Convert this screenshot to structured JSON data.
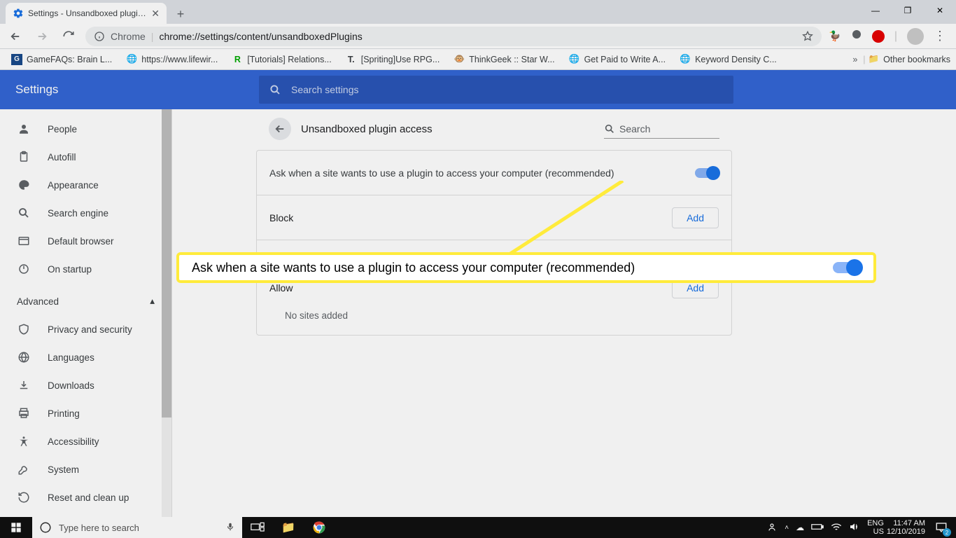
{
  "browser": {
    "tab_title": "Settings - Unsandboxed plugin a",
    "url_prefix": "Chrome",
    "url_path": "chrome://settings/content/unsandboxedPlugins",
    "bookmarks": [
      "GameFAQs: Brain L...",
      "https://www.lifewir...",
      "[Tutorials] Relations...",
      "[Spriting]Use RPG...",
      "ThinkGeek :: Star W...",
      "Get Paid to Write A...",
      "Keyword Density C..."
    ],
    "other_bookmarks": "Other bookmarks"
  },
  "settings": {
    "title": "Settings",
    "search_placeholder": "Search settings",
    "sidebar": {
      "items": [
        {
          "label": "People"
        },
        {
          "label": "Autofill"
        },
        {
          "label": "Appearance"
        },
        {
          "label": "Search engine"
        },
        {
          "label": "Default browser"
        },
        {
          "label": "On startup"
        }
      ],
      "advanced_label": "Advanced",
      "advanced_items": [
        {
          "label": "Privacy and security"
        },
        {
          "label": "Languages"
        },
        {
          "label": "Downloads"
        },
        {
          "label": "Printing"
        },
        {
          "label": "Accessibility"
        },
        {
          "label": "System"
        },
        {
          "label": "Reset and clean up"
        }
      ]
    },
    "panel": {
      "title": "Unsandboxed plugin access",
      "search_placeholder": "Search",
      "ask_label": "Ask when a site wants to use a plugin to access your computer (recommended)",
      "block_label": "Block",
      "allow_label": "Allow",
      "add_label": "Add",
      "no_sites": "No sites added"
    }
  },
  "callout": {
    "text": "Ask when a site wants to use a plugin to access your computer (recommended)"
  },
  "taskbar": {
    "search_placeholder": "Type here to search",
    "lang1": "ENG",
    "lang2": "US",
    "time": "11:47 AM",
    "date": "12/10/2019",
    "notif_count": "2"
  }
}
